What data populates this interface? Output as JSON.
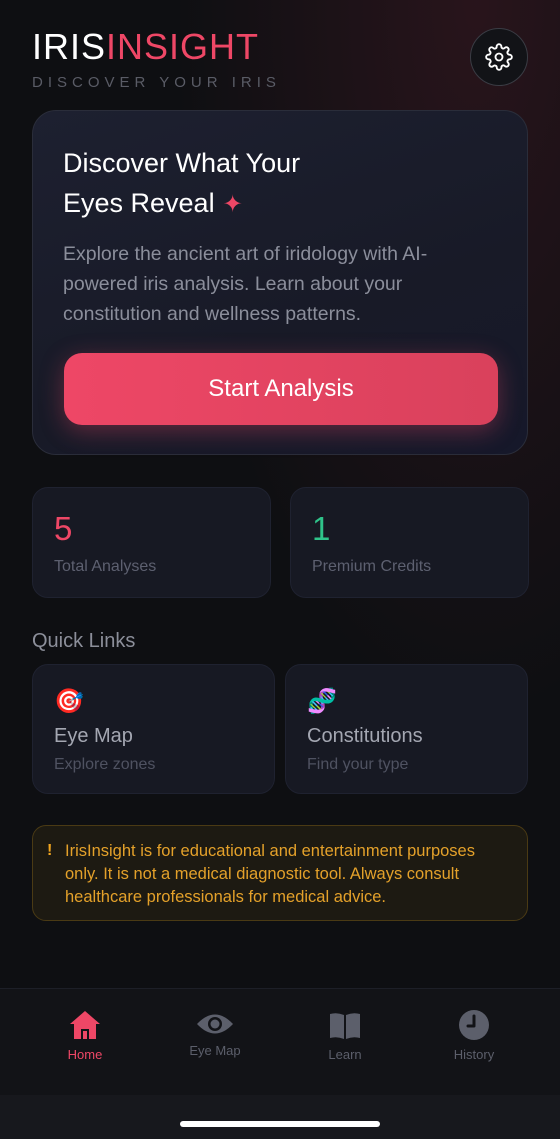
{
  "header": {
    "brand_part1": "IRIS",
    "brand_part2": "INSIGHT",
    "tagline": "DISCOVER YOUR IRIS",
    "settings_icon": "gear-icon"
  },
  "hero": {
    "title_line1": "Discover What Your",
    "title_line2": "Eyes Reveal",
    "sparkle": "✦",
    "description": "Explore the ancient art of iridology with AI-powered iris analysis. Learn about your constitution and wellness patterns.",
    "button_label": "Start Analysis"
  },
  "stats": [
    {
      "value": "5",
      "label": "Total Analyses",
      "color": "#ee4766"
    },
    {
      "value": "1",
      "label": "Premium Credits",
      "color": "#2fc38a"
    }
  ],
  "quick_links": {
    "title": "Quick Links",
    "items": [
      {
        "icon": "🎯",
        "title": "Eye Map",
        "subtitle": "Explore zones"
      },
      {
        "icon": "🧬",
        "title": "Constitutions",
        "subtitle": "Find your type"
      }
    ]
  },
  "disclaimer": {
    "icon": "!",
    "text": "IrisInsight is for educational and entertainment purposes only. It is not a medical diagnostic tool. Always consult healthcare professionals for medical advice."
  },
  "nav": {
    "items": [
      {
        "label": "Home",
        "icon": "home-icon",
        "active": true
      },
      {
        "label": "Eye Map",
        "icon": "eye-icon",
        "active": false
      },
      {
        "label": "Learn",
        "icon": "book-icon",
        "active": false
      },
      {
        "label": "History",
        "icon": "clock-icon",
        "active": false
      }
    ]
  },
  "colors": {
    "accent": "#ee4766",
    "success": "#2fc38a",
    "warning": "#e4a12a",
    "background": "#0e0f12"
  }
}
